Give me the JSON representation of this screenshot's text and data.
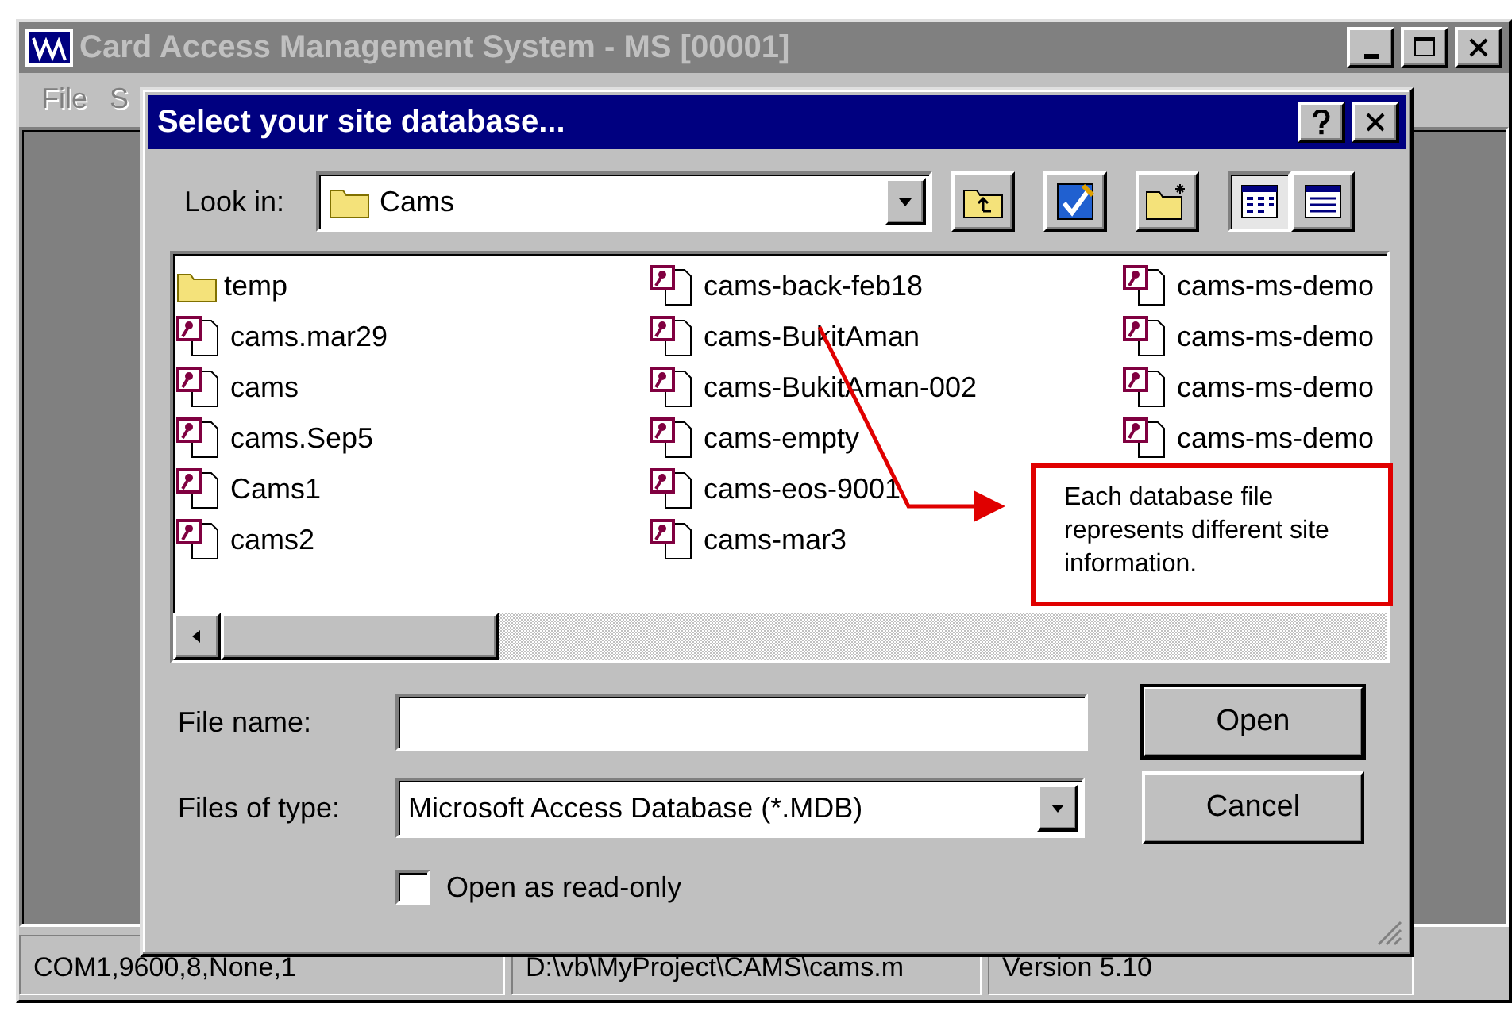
{
  "main_window": {
    "title": "Card Access Management System - MS [00001]",
    "menu": [
      "File",
      "S"
    ],
    "status_bar": [
      "COM1,9600,8,None,1",
      "D:\\vb\\MyProject\\CAMS\\cams.m",
      "Version 5.10"
    ]
  },
  "dialog": {
    "title": "Select your site database...",
    "look_in": {
      "label": "Look in:",
      "value": "Cams"
    },
    "view_buttons": [
      {
        "kind": "list",
        "selected": true
      },
      {
        "kind": "details",
        "selected": false
      }
    ],
    "files": [
      {
        "name": "temp",
        "kind": "folder"
      },
      {
        "name": "cams.mar29",
        "kind": "database"
      },
      {
        "name": "cams",
        "kind": "database"
      },
      {
        "name": "cams.Sep5",
        "kind": "database"
      },
      {
        "name": "Cams1",
        "kind": "database"
      },
      {
        "name": "cams2",
        "kind": "database"
      },
      {
        "name": "cams-back-feb18",
        "kind": "database"
      },
      {
        "name": "cams-BukitAman",
        "kind": "database"
      },
      {
        "name": "cams-BukitAman-002",
        "kind": "database"
      },
      {
        "name": "cams-empty",
        "kind": "database"
      },
      {
        "name": "cams-eos-9001",
        "kind": "database"
      },
      {
        "name": "cams-mar3",
        "kind": "database"
      },
      {
        "name": "cams-ms-demo",
        "kind": "database"
      },
      {
        "name": "cams-ms-demo",
        "kind": "database"
      },
      {
        "name": "cams-ms-demo",
        "kind": "database"
      },
      {
        "name": "cams-ms-demo",
        "kind": "database"
      }
    ],
    "file_name": {
      "label": "File name:"
    },
    "file_type": {
      "label": "Files of type:",
      "value": "Microsoft Access Database (*.MDB)"
    },
    "read_only": {
      "label": "Open as read-only",
      "checked": false
    },
    "buttons": [
      {
        "label": "Open",
        "default": true
      },
      {
        "label": "Cancel",
        "default": false
      }
    ]
  },
  "callout": {
    "text": "Each database file represents different site information."
  }
}
